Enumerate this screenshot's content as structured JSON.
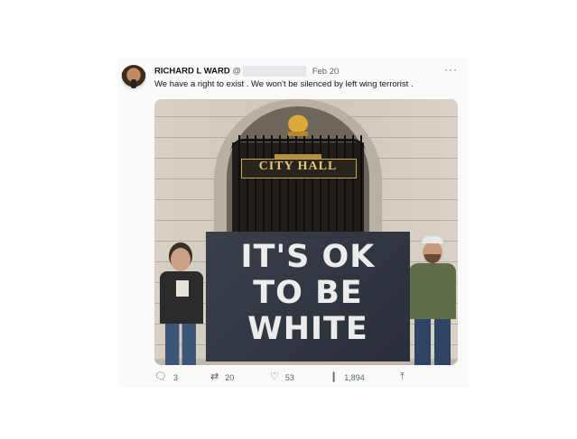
{
  "tweet": {
    "author_name": "RICHARD L WARD",
    "handle_prefix": "@",
    "date": "Feb 20",
    "more_icon": "···",
    "text": "We have a right to exist . We won't be silenced by left wing terrorist ."
  },
  "photo": {
    "sign_text": "CITY HALL",
    "banner_lines": [
      "IT'S OK",
      "TO BE",
      "WHITE"
    ]
  },
  "actions": {
    "replies": "3",
    "retweets": "20",
    "likes": "53",
    "views": "1,894"
  },
  "icons": {
    "reply": "reply-icon",
    "retweet": "retweet-icon",
    "like": "heart-icon",
    "views": "bar-chart-icon",
    "share": "share-icon"
  }
}
